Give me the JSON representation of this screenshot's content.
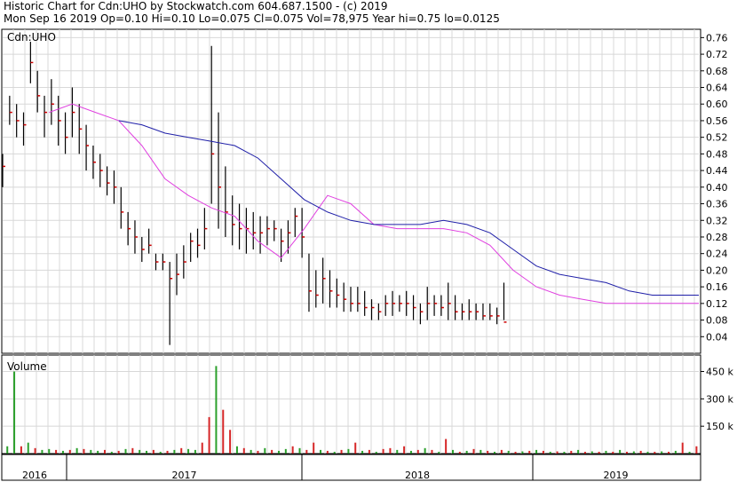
{
  "header": {
    "line1": "Historic Chart for Cdn:UHO by Stockwatch.com 604.687.1500 - (c) 2019",
    "line2": "Mon Sep 16 2019   Op=0.10   Hi=0.10   Lo=0.075   Cl=0.075   Vol=78,975   Year hi=0.75   lo=0.0125"
  },
  "colors": {
    "up_volume": "#2ca02c",
    "down_volume": "#d62728",
    "price_bar": "#000000",
    "close_tick": "#cc0000",
    "ma_short": "#e040e0",
    "ma_long": "#1f1fa8",
    "grid": "#d8d8d8"
  },
  "chart_data": [
    {
      "type": "line",
      "title": "Cdn:UHO",
      "ylim": [
        0.0,
        0.78
      ],
      "y_ticks": [
        "0.76",
        "0.72",
        "0.68",
        "0.64",
        "0.60",
        "0.56",
        "0.52",
        "0.48",
        "0.44",
        "0.40",
        "0.36",
        "0.32",
        "0.28",
        "0.24",
        "0.20",
        "0.16",
        "0.12",
        "0.08",
        "0.04"
      ],
      "x_years": [
        "2016",
        "2017",
        "2018",
        "2019"
      ],
      "series": [
        {
          "name": "",
          "kind": "price_hl",
          "x": [
            0,
            3,
            6,
            9,
            12,
            15,
            18,
            21,
            24,
            27,
            30,
            33,
            36,
            39,
            42,
            45,
            48,
            51,
            54,
            57,
            60,
            63,
            66,
            69,
            72,
            75,
            78,
            81,
            84,
            87,
            90,
            93,
            96,
            99,
            102,
            105,
            108,
            111,
            114,
            117,
            120,
            123,
            126,
            129,
            132,
            135,
            138,
            141,
            144,
            147,
            150,
            153,
            156,
            159,
            162,
            165,
            168,
            171,
            174,
            177,
            180,
            183,
            186,
            189,
            192,
            195,
            198,
            201,
            204,
            207,
            210,
            213,
            216,
            219,
            222,
            225,
            228,
            231,
            234,
            237,
            240,
            243,
            246,
            249,
            252,
            255,
            258,
            261,
            264,
            267,
            270,
            273,
            276,
            279,
            282,
            285,
            288,
            291,
            294,
            297,
            300
          ],
          "high": [
            0.48,
            0.62,
            0.6,
            0.58,
            0.75,
            0.68,
            0.62,
            0.66,
            0.62,
            0.58,
            0.64,
            0.6,
            0.55,
            0.5,
            0.48,
            0.45,
            0.44,
            0.4,
            0.34,
            0.32,
            0.28,
            0.3,
            0.24,
            0.24,
            0.22,
            0.24,
            0.26,
            0.29,
            0.3,
            0.35,
            0.74,
            0.58,
            0.45,
            0.38,
            0.36,
            0.35,
            0.34,
            0.33,
            0.33,
            0.32,
            0.3,
            0.32,
            0.35,
            0.35,
            0.24,
            0.2,
            0.23,
            0.2,
            0.18,
            0.17,
            0.16,
            0.16,
            0.15,
            0.13,
            0.12,
            0.14,
            0.15,
            0.14,
            0.15,
            0.14,
            0.12,
            0.16,
            0.14,
            0.14,
            0.17,
            0.14,
            0.12,
            0.13,
            0.12,
            0.12,
            0.12,
            0.11,
            0.17
          ],
          "low": [
            0.4,
            0.55,
            0.52,
            0.5,
            0.65,
            0.58,
            0.52,
            0.55,
            0.5,
            0.48,
            0.52,
            0.48,
            0.44,
            0.42,
            0.4,
            0.38,
            0.36,
            0.3,
            0.26,
            0.24,
            0.22,
            0.24,
            0.2,
            0.2,
            0.02,
            0.14,
            0.18,
            0.22,
            0.23,
            0.25,
            0.36,
            0.3,
            0.28,
            0.26,
            0.25,
            0.24,
            0.25,
            0.24,
            0.26,
            0.27,
            0.22,
            0.24,
            0.28,
            0.23,
            0.1,
            0.11,
            0.12,
            0.11,
            0.11,
            0.1,
            0.1,
            0.1,
            0.09,
            0.08,
            0.08,
            0.09,
            0.09,
            0.1,
            0.09,
            0.08,
            0.07,
            0.08,
            0.09,
            0.09,
            0.08,
            0.08,
            0.08,
            0.08,
            0.08,
            0.08,
            0.08,
            0.07,
            0.08
          ],
          "close": [
            0.45,
            0.58,
            0.56,
            0.55,
            0.7,
            0.62,
            0.58,
            0.6,
            0.56,
            0.52,
            0.58,
            0.54,
            0.5,
            0.46,
            0.44,
            0.41,
            0.4,
            0.34,
            0.3,
            0.28,
            0.25,
            0.26,
            0.22,
            0.22,
            0.18,
            0.19,
            0.22,
            0.27,
            0.26,
            0.3,
            0.48,
            0.4,
            0.34,
            0.31,
            0.3,
            0.3,
            0.29,
            0.29,
            0.3,
            0.3,
            0.27,
            0.29,
            0.33,
            0.28,
            0.15,
            0.14,
            0.18,
            0.15,
            0.14,
            0.13,
            0.12,
            0.12,
            0.11,
            0.11,
            0.1,
            0.12,
            0.12,
            0.12,
            0.12,
            0.11,
            0.1,
            0.12,
            0.12,
            0.11,
            0.12,
            0.1,
            0.1,
            0.1,
            0.1,
            0.09,
            0.09,
            0.09,
            0.075
          ]
        },
        {
          "name": "",
          "kind": "ma_short",
          "x": [
            20,
            30,
            40,
            50,
            60,
            70,
            80,
            90,
            100,
            110,
            120,
            130,
            140,
            150,
            160,
            170,
            180,
            190,
            200,
            210,
            220,
            230,
            240,
            250,
            260,
            270,
            280,
            290,
            300
          ],
          "values": [
            0.58,
            0.6,
            0.58,
            0.56,
            0.5,
            0.42,
            0.38,
            0.35,
            0.33,
            0.27,
            0.23,
            0.3,
            0.38,
            0.36,
            0.31,
            0.3,
            0.3,
            0.3,
            0.29,
            0.26,
            0.2,
            0.16,
            0.14,
            0.13,
            0.12,
            0.12,
            0.12,
            0.12,
            0.12
          ]
        },
        {
          "name": "",
          "kind": "ma_long",
          "x": [
            50,
            60,
            70,
            80,
            90,
            100,
            110,
            120,
            130,
            140,
            150,
            160,
            170,
            180,
            190,
            200,
            210,
            220,
            230,
            240,
            250,
            260,
            270,
            280,
            290,
            300
          ],
          "values": [
            0.56,
            0.55,
            0.53,
            0.52,
            0.51,
            0.5,
            0.47,
            0.42,
            0.37,
            0.34,
            0.32,
            0.31,
            0.31,
            0.31,
            0.32,
            0.31,
            0.29,
            0.25,
            0.21,
            0.19,
            0.18,
            0.17,
            0.15,
            0.14,
            0.14,
            0.14
          ]
        }
      ]
    },
    {
      "type": "bar",
      "title": "Volume",
      "ylim": [
        0,
        540
      ],
      "y_ticks": [
        "450 k",
        "300 k",
        "150 k"
      ],
      "series": [
        {
          "name": "",
          "x": [
            2,
            5,
            8,
            11,
            14,
            17,
            20,
            23,
            26,
            29,
            32,
            35,
            38,
            41,
            44,
            47,
            50,
            53,
            56,
            59,
            62,
            65,
            68,
            71,
            74,
            77,
            80,
            83,
            86,
            89,
            92,
            95,
            98,
            101,
            104,
            107,
            110,
            113,
            116,
            119,
            122,
            125,
            128,
            131,
            134,
            137,
            140,
            143,
            146,
            149,
            152,
            155,
            158,
            161,
            164,
            167,
            170,
            173,
            176,
            179,
            182,
            185,
            188,
            191,
            194,
            197,
            200,
            203,
            206,
            209,
            212,
            215,
            218,
            221,
            224,
            227,
            230,
            233,
            236,
            239,
            242,
            245,
            248,
            251,
            254,
            257,
            260,
            263,
            266,
            269,
            272,
            275,
            278,
            281,
            284,
            287,
            290,
            293,
            296,
            299
          ],
          "values": [
            40,
            450,
            40,
            60,
            30,
            20,
            25,
            20,
            15,
            20,
            30,
            25,
            20,
            15,
            20,
            10,
            15,
            25,
            30,
            20,
            15,
            20,
            10,
            15,
            20,
            30,
            25,
            20,
            60,
            200,
            480,
            240,
            130,
            40,
            30,
            20,
            15,
            30,
            20,
            15,
            25,
            40,
            30,
            20,
            60,
            20,
            15,
            10,
            20,
            25,
            60,
            15,
            20,
            10,
            25,
            30,
            20,
            40,
            15,
            20,
            30,
            20,
            10,
            80,
            20,
            10,
            15,
            25,
            20,
            15,
            10,
            20,
            15,
            10,
            12,
            15,
            20,
            15,
            10,
            12,
            10,
            15,
            20,
            10,
            12,
            10,
            15,
            10,
            20,
            10,
            12,
            15,
            10,
            10,
            12,
            10,
            15,
            60,
            10,
            40
          ],
          "up": [
            1,
            1,
            0,
            1,
            0,
            1,
            1,
            0,
            1,
            0,
            1,
            0,
            1,
            1,
            0,
            1,
            0,
            1,
            0,
            1,
            1,
            0,
            1,
            0,
            1,
            0,
            1,
            1,
            0,
            0,
            1,
            0,
            0,
            1,
            0,
            1,
            0,
            1,
            0,
            1,
            1,
            0,
            1,
            0,
            0,
            1,
            0,
            1,
            0,
            1,
            0,
            1,
            0,
            1,
            0,
            0,
            1,
            0,
            1,
            0,
            1,
            0,
            1,
            0,
            1,
            0,
            1,
            0,
            1,
            0,
            1,
            0,
            1,
            0,
            1,
            0,
            1,
            0,
            1,
            0,
            1,
            0,
            1,
            0,
            1,
            0,
            1,
            0,
            1,
            0,
            1,
            0,
            1,
            0,
            1,
            0,
            1,
            0,
            1,
            0
          ]
        }
      ]
    }
  ]
}
